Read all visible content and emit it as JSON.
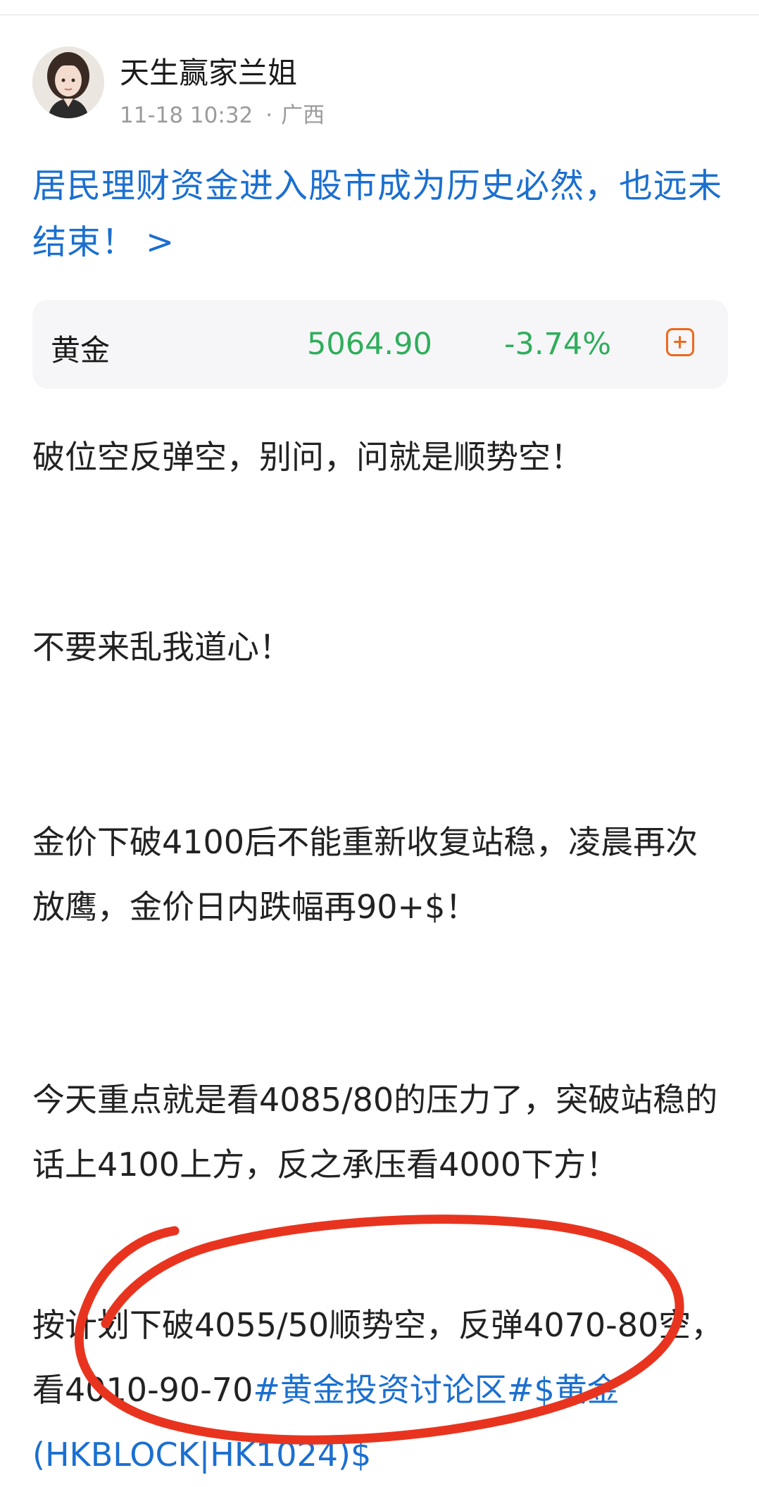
{
  "author": {
    "name": "天生赢家兰姐",
    "time": "11-18 10:32",
    "separator": "·",
    "location": "广西"
  },
  "headline_link": {
    "text": "居民理财资金进入股市成为历史必然，也远未结束！",
    "arrow": ">"
  },
  "stock_card": {
    "name": "黄金",
    "price": "5064.90",
    "change": "-3.74%",
    "change_color": "#2fae5b",
    "add_icon": "plus-square-icon",
    "add_icon_color": "#ec6a1d"
  },
  "post": {
    "paragraphs": [
      "破位空反弹空，别问，问就是顺势空！",
      "不要来乱我道心！",
      "金价下破4100后不能重新收复站稳，凌晨再次放鹰，金价日内跌幅再90+$！",
      "今天重点就是看4085/80的压力了，突破站稳的话上4100上方，反之承压看4000下方！"
    ],
    "last_paragraph_text": "按计划下破4055/50顺势空，反弹4070-80空，看4010-90-70",
    "hashtag": "#黄金投资讨论区#",
    "stock_tag": "$黄金(HKBLOCK|HK1024)$"
  },
  "annotation": {
    "stroke_color": "#e8341f",
    "shape": "hand-drawn-circle"
  },
  "colors": {
    "link_blue": "#1b6fd0",
    "meta_gray": "#9b9b9b",
    "card_bg": "#f6f6f8"
  }
}
